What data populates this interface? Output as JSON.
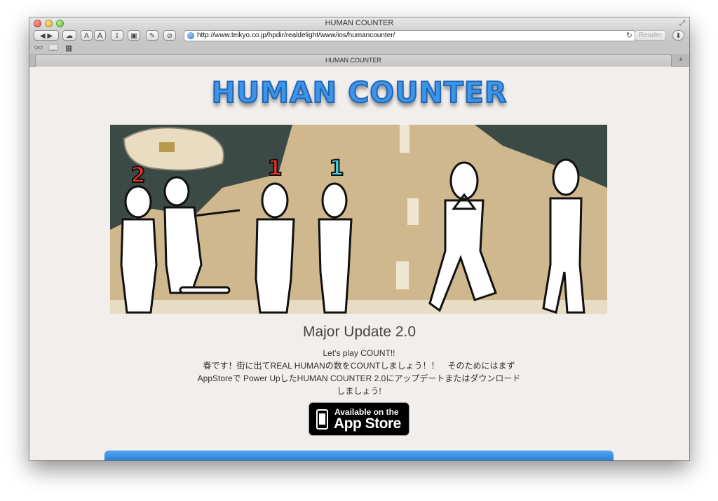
{
  "window": {
    "title": "HUMAN COUNTER",
    "url": "http://www.teikyo.co.jp/hpdir/realdelight/www/ios/humancounter/",
    "reader_label": "Reader",
    "tab_title": "HUMAN COUNTER",
    "text_smaller": "A",
    "text_bigger": "A"
  },
  "page": {
    "logo": "HUMAN COUNTER",
    "counters": [
      "2",
      "1",
      "1"
    ],
    "heading": "Major Update 2.0",
    "tagline": "Let's play COUNT!!",
    "line1": "春です！街に出てREAL HUMANの数をCOUNTしましょう！！　そのためにはまず",
    "line2": "AppStoreで Power UpしたHUMAN COUNTER 2.0にアップデートまたはダウンロード",
    "line3": "しましょう!",
    "badge_small": "Available on the",
    "badge_big": "App Store"
  },
  "colors": {
    "logo_blue": "#3d95e8",
    "counter_red": "#e8321f",
    "counter_cyan": "#3fd6e6",
    "road_tan": "#cfb88e",
    "asphalt": "#3c4a45"
  }
}
